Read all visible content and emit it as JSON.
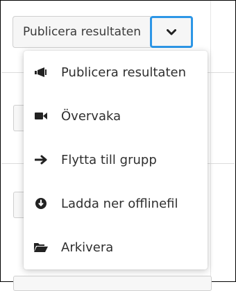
{
  "toolbar": {
    "publish_label": "Publicera resultaten",
    "toggle_icon": "chevron-down-icon",
    "focus_color": "#2d96e6"
  },
  "menu": {
    "items": [
      {
        "label": "Publicera resultaten",
        "icon": "megaphone-icon"
      },
      {
        "label": "Övervaka",
        "icon": "video-camera-icon"
      },
      {
        "label": "Flytta till grupp",
        "icon": "arrow-right-icon"
      },
      {
        "label": "Ladda ner offlinefil",
        "icon": "download-circle-icon"
      },
      {
        "label": "Arkivera",
        "icon": "folder-open-icon"
      }
    ]
  }
}
